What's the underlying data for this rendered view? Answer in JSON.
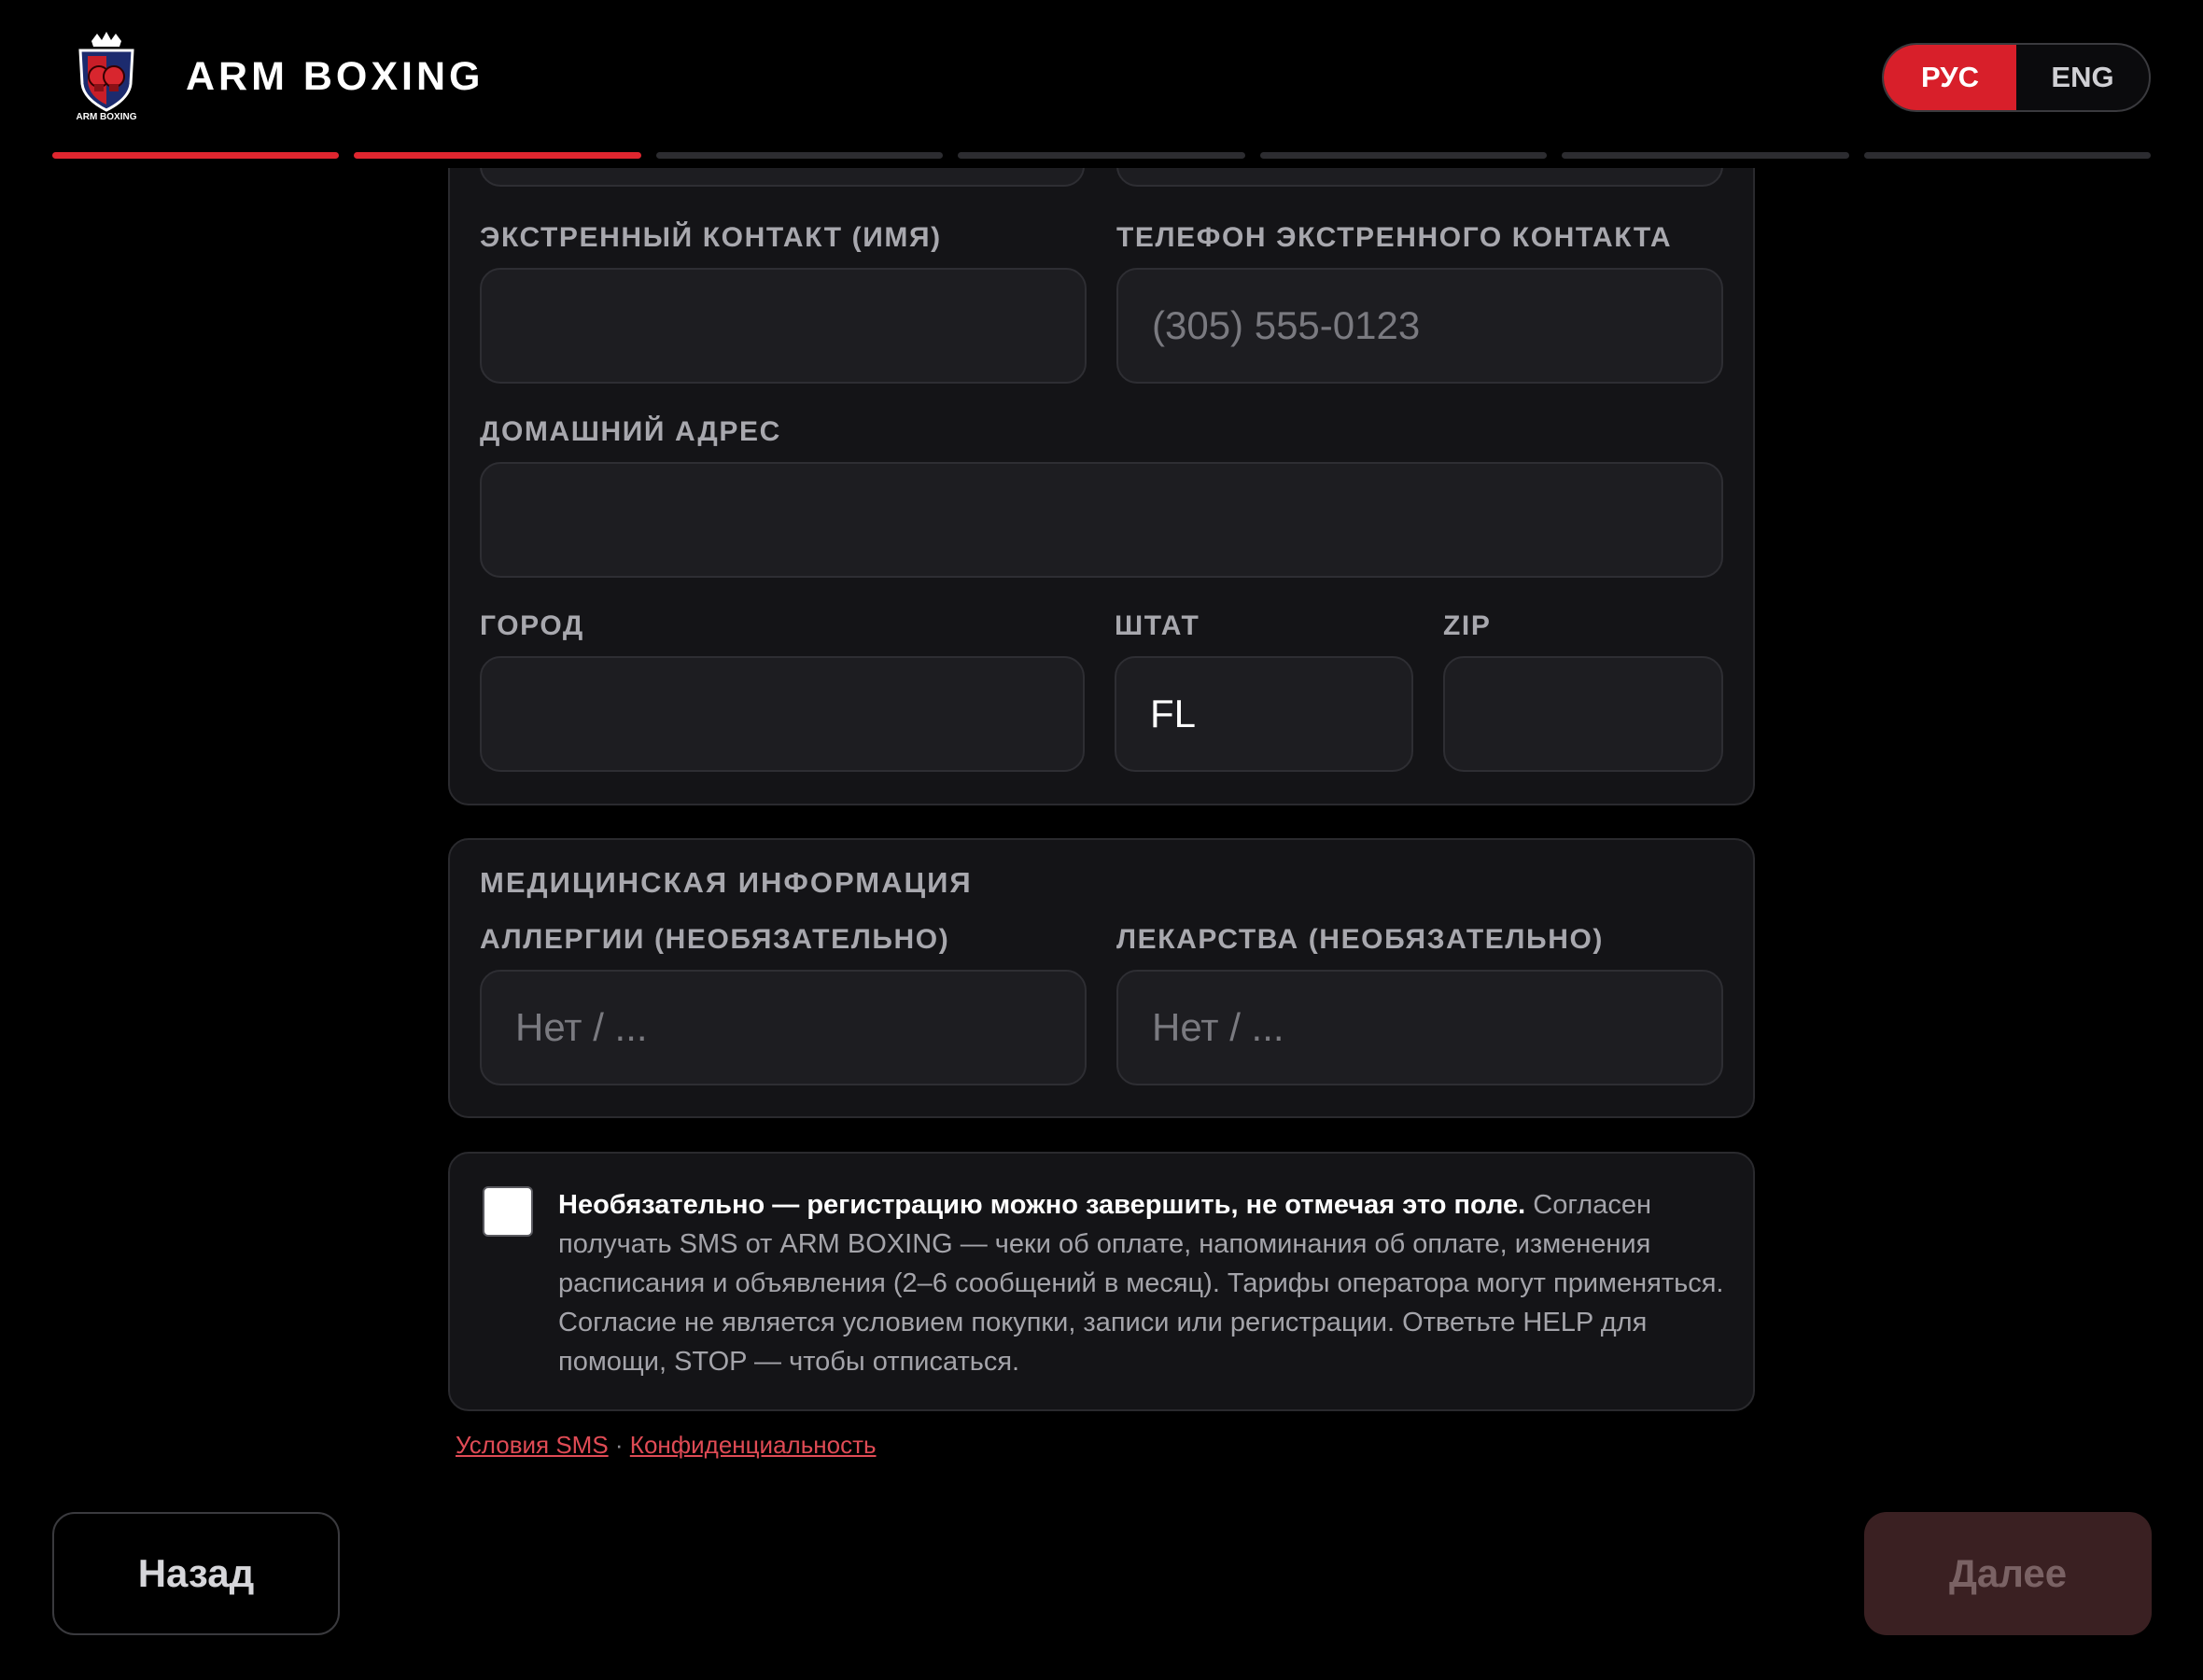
{
  "header": {
    "logo_text": "ARM BOXING",
    "brand": "ARM BOXING",
    "lang_options": [
      "РУС",
      "ENG"
    ],
    "lang_selected": "РУС",
    "progress": {
      "total": 7,
      "completed": 2
    }
  },
  "contact": {
    "emergency_name_label": "ЭКСТРЕННЫЙ КОНТАКТ (ИМЯ)",
    "emergency_name_value": "",
    "emergency_phone_label": "ТЕЛЕФОН ЭКСТРЕННОГО КОНТАКТА",
    "emergency_phone_placeholder": "(305) 555-0123",
    "address_label": "ДОМАШНИЙ АДРЕС",
    "address_value": "",
    "city_label": "ГОРОД",
    "city_value": "",
    "state_label": "ШТАТ",
    "state_value": "FL",
    "zip_label": "ZIP",
    "zip_value": ""
  },
  "medical": {
    "title": "МЕДИЦИНСКАЯ ИНФОРМАЦИЯ",
    "allergies_label": "АЛЛЕРГИИ (НЕОБЯЗАТЕЛЬНО)",
    "allergies_placeholder": "Нет / ...",
    "medications_label": "ЛЕКАРСТВА (НЕОБЯЗАТЕЛЬНО)",
    "medications_placeholder": "Нет / ..."
  },
  "sms": {
    "checked": false,
    "bold": "Необязательно — регистрацию можно завершить, не отмечая это поле.",
    "text": " Согласен получать SMS от ARM BOXING — чеки об оплате, напоминания об оплате, изменения расписания и объявления (2–6 сообщений в месяц). Тарифы оператора могут применяться. Согласие не является условием покупки, записи или регистрации. Ответьте HELP для помощи, STOP — чтобы отписаться."
  },
  "links": {
    "sms_terms": "Условия SMS",
    "separator": " · ",
    "privacy": "Конфиденциальность"
  },
  "buttons": {
    "back": "Назад",
    "next": "Далее"
  },
  "colors": {
    "accent": "#e0262f",
    "background": "#000000",
    "card": "#141417"
  }
}
